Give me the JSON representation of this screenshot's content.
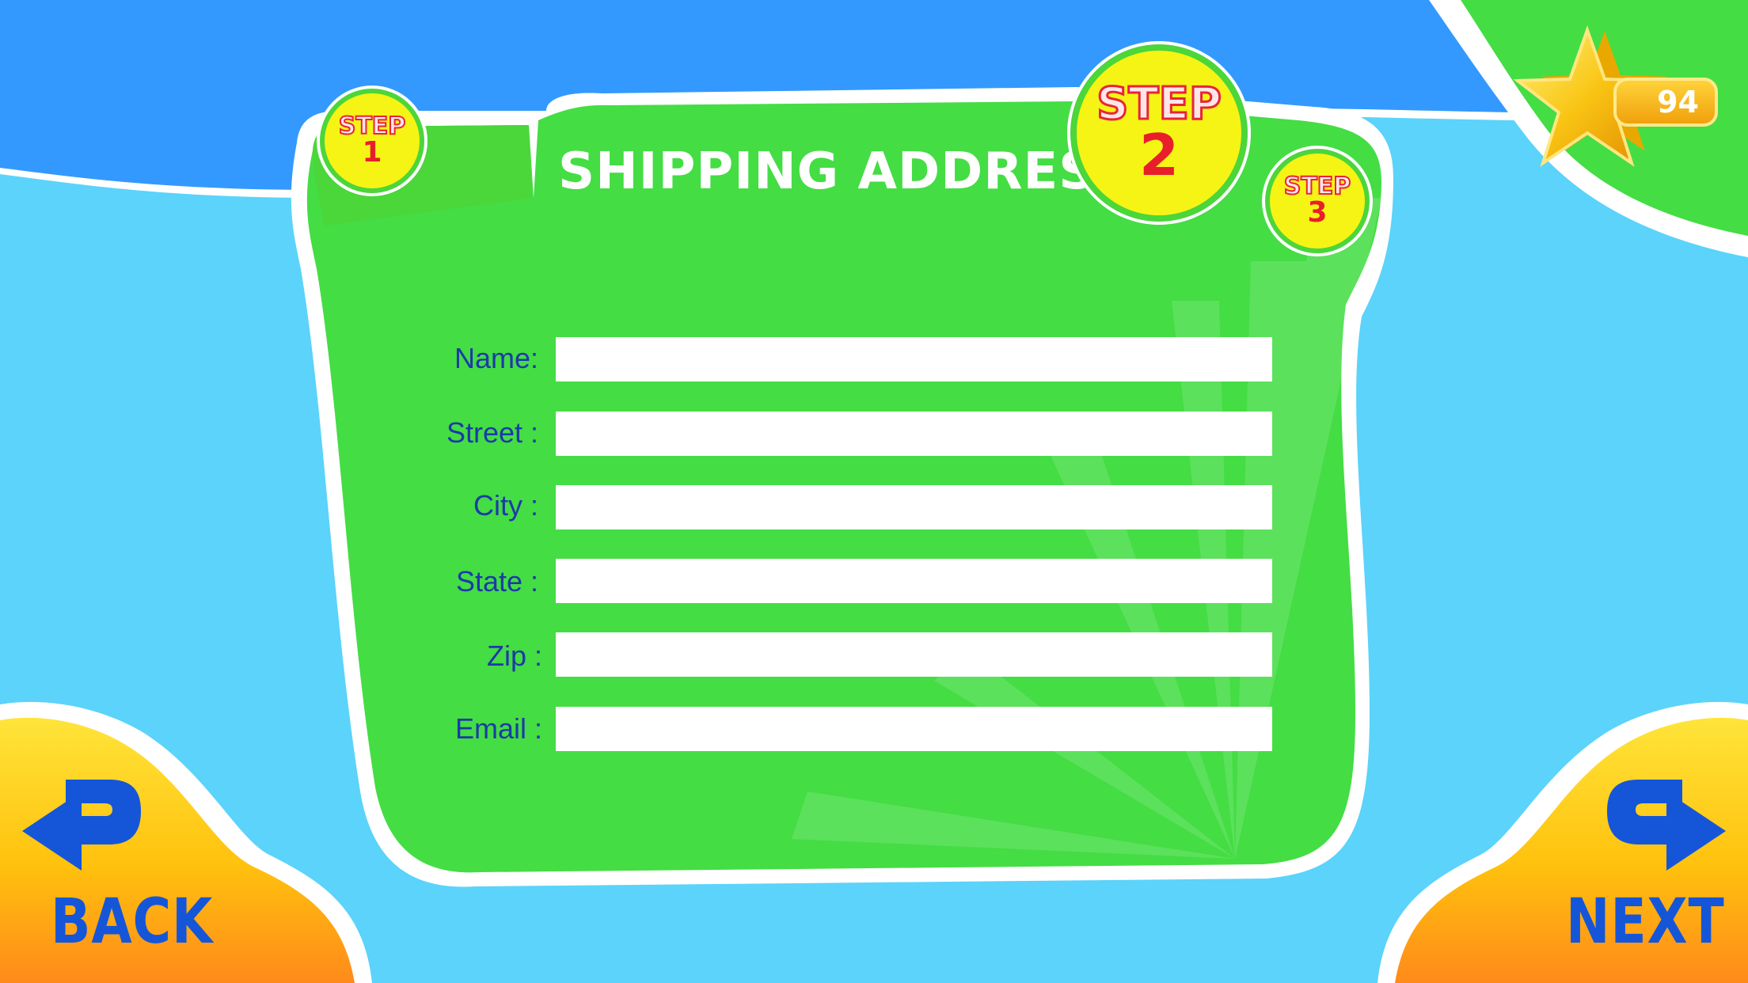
{
  "header": {
    "title": "SHIPPING ADDRESS"
  },
  "steps": [
    {
      "word": "STEP",
      "number": "1",
      "active": false
    },
    {
      "word": "STEP",
      "number": "2",
      "active": true
    },
    {
      "word": "STEP",
      "number": "3",
      "active": false
    }
  ],
  "score": {
    "value": "94",
    "icon": "star-icon"
  },
  "form": {
    "fields": [
      {
        "label": "Name:",
        "value": ""
      },
      {
        "label": "Street :",
        "value": ""
      },
      {
        "label": "City :",
        "value": ""
      },
      {
        "label": "State :",
        "value": ""
      },
      {
        "label": "Zip :",
        "value": ""
      },
      {
        "label": "Email :",
        "value": ""
      }
    ]
  },
  "nav": {
    "back_label": "BACK",
    "next_label": "NEXT",
    "back_icon": "back-arrow-icon",
    "next_icon": "next-arrow-icon"
  },
  "colors": {
    "sky": "#3399ff",
    "background": "#5bd3fb",
    "panel": "#44dd44",
    "button": "#ffc20e",
    "accent_text": "#1556d8",
    "step_red": "#e81f2b"
  }
}
